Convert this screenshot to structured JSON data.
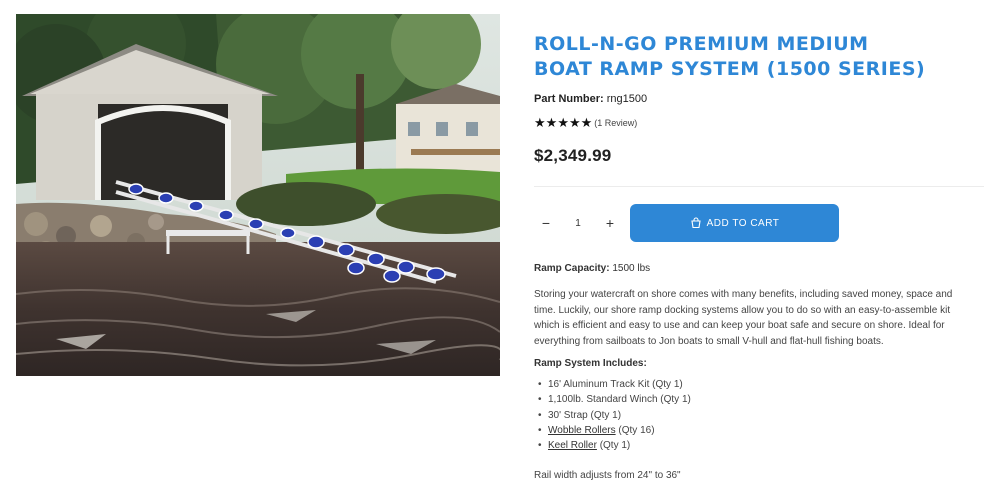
{
  "product": {
    "title_line1": "ROLL-N-GO PREMIUM MEDIUM",
    "title_line2": "BOAT RAMP SYSTEM (1500 SERIES)",
    "part_label": "Part Number:",
    "part_value": "rng1500",
    "rating_stars": 5,
    "reviews": "(1 Review)",
    "price": "$2,349.99"
  },
  "purchase": {
    "qty_minus": "−",
    "qty_value": "1",
    "qty_plus": "+",
    "add_to_cart": "ADD TO CART"
  },
  "details": {
    "capacity_label": "Ramp Capacity:",
    "capacity_value": "1500 lbs",
    "description": "Storing your watercraft on shore comes with many benefits, including saved money, space and time. Luckily, our shore ramp docking systems allow you to do so with an easy-to-assemble kit which is efficient and easy to use and can keep your boat safe and secure on shore. Ideal for everything from sailboats to Jon boats to small V-hull and flat-hull fishing boats.",
    "includes_heading": "Ramp System Includes:",
    "includes": [
      {
        "text": "16' Aluminum Track Kit (Qty 1)"
      },
      {
        "text": "1,100lb. Standard Winch (Qty 1)"
      },
      {
        "text": "30' Strap (Qty 1)"
      },
      {
        "link": "Wobble Rollers",
        "text": " (Qty 16)"
      },
      {
        "link": "Keel Roller",
        "text": " (Qty 1)"
      }
    ],
    "rail_width": "Rail width adjusts from 24\" to 36\""
  },
  "colors": {
    "accent": "#2e87d6",
    "roller_blue": "#2b3fb3",
    "water": "#4b3a33"
  },
  "icons": {
    "cart": "cart-icon",
    "star": "star-icon"
  }
}
